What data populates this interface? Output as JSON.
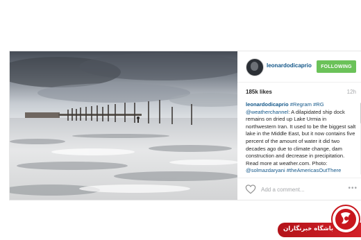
{
  "post": {
    "photo_alt": "dried up Lake Urmia ship dock",
    "username": "leonardodicaprio",
    "follow_label": "FOLLOWING",
    "likes": "185k likes",
    "age": "12h",
    "caption": {
      "username": "leonardodicaprio",
      "tags": "#Regram #RG",
      "mention": "@weatherchannel",
      "text": ": A dilapidated ship dock remains on dried up Lake Urmia in northwestern Iran. It used to be the biggest salt lake in the Middle East, but it now contains five percent of the amount of water it did two decades ago due to climate change, dam construction and decrease in precipitation. Read more at weather.com. Photo: ",
      "photo_credit": "@solmazdaryani",
      "trailing_tag": "#theAmericasOutThere"
    },
    "comment_placeholder": "Add a comment...",
    "more_label": "•••"
  },
  "badge": {
    "text": "باشگاه خبرنگاران",
    "accent": "#c8161d"
  },
  "colors": {
    "link": "#125688",
    "follow_green": "#6bc259",
    "muted": "#a5a7aa"
  },
  "icons": {
    "like": "heart-outline-icon",
    "avatar": "profile-avatar",
    "badge_logo": "news-agency-logo"
  }
}
